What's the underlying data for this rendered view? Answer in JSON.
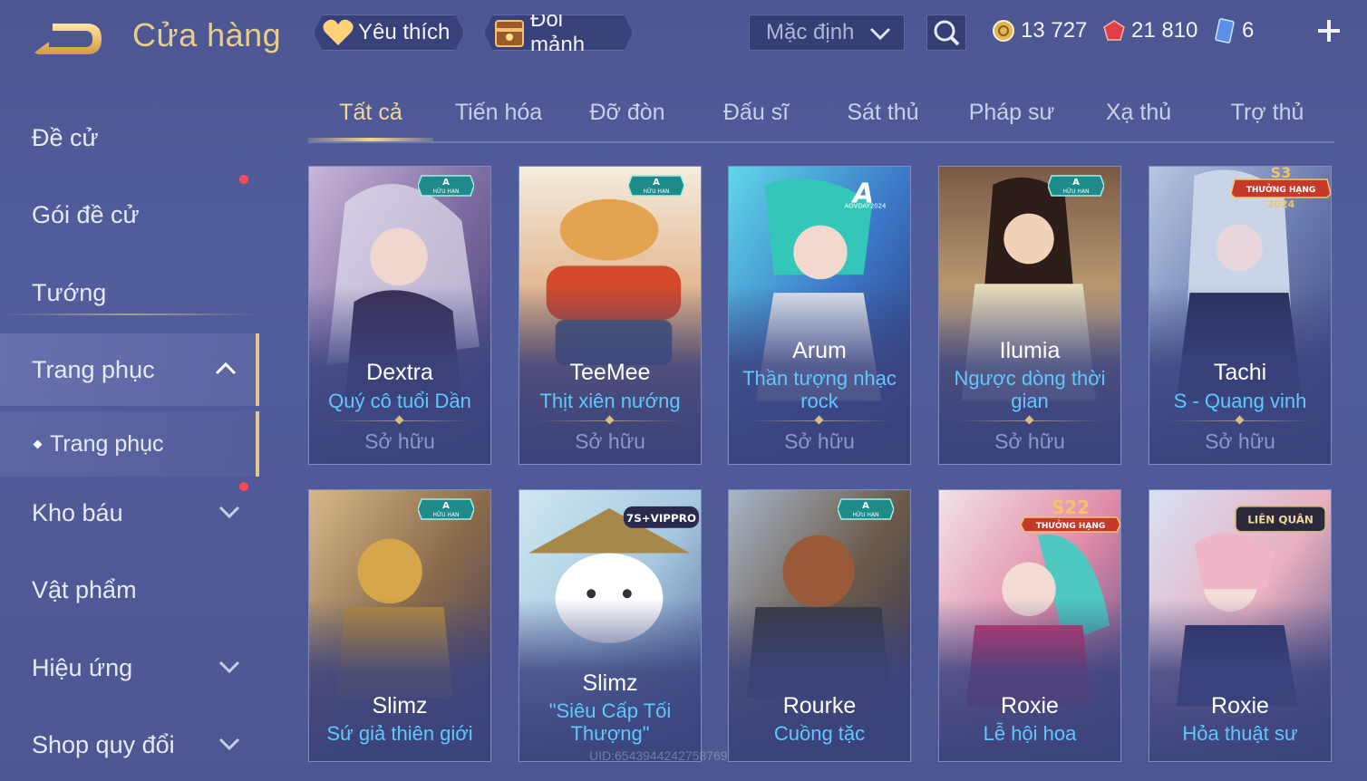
{
  "header": {
    "title": "Cửa hàng",
    "favorite_label": "Yêu thích",
    "trade_label": "Đổi mảnh",
    "sort_value": "Mặc định",
    "currencies": [
      {
        "icon": "gold-coin-icon",
        "value": "13 727"
      },
      {
        "icon": "red-gem-icon",
        "value": "21 810"
      },
      {
        "icon": "blue-card-icon",
        "value": "6"
      }
    ]
  },
  "sidebar": {
    "items": [
      {
        "label": "Đề cử"
      },
      {
        "label": "Gói đề cử"
      },
      {
        "label": "Tướng"
      },
      {
        "label": "Trang phục"
      },
      {
        "label": "Trang phục"
      },
      {
        "label": "Kho báu"
      },
      {
        "label": "Vật phẩm"
      },
      {
        "label": "Hiệu ứng"
      },
      {
        "label": "Shop quy đổi"
      }
    ]
  },
  "tabs": [
    {
      "label": "Tất cả"
    },
    {
      "label": "Tiến hóa"
    },
    {
      "label": "Đỡ đòn"
    },
    {
      "label": "Đấu sĩ"
    },
    {
      "label": "Sát thủ"
    },
    {
      "label": "Pháp sư"
    },
    {
      "label": "Xạ thủ"
    },
    {
      "label": "Trợ thủ"
    }
  ],
  "cards": [
    {
      "hero": "Dextra",
      "skin": "Quý cô tuổi Dần",
      "status": "Sở hữu",
      "badge": "A",
      "badge_sub": "HỮU HẠN"
    },
    {
      "hero": "TeeMee",
      "skin": "Thịt xiên nướng",
      "status": "Sở hữu",
      "badge": "A",
      "badge_sub": "HỮU HẠN"
    },
    {
      "hero": "Arum",
      "skin": "Thần tượng nhạc rock",
      "status": "Sở hữu",
      "badge": "A",
      "badge_sub": "AOVDAY2024"
    },
    {
      "hero": "Ilumia",
      "skin": "Ngược dòng thời gian",
      "status": "Sở hữu",
      "badge": "A",
      "badge_sub": "HỮU HẠN"
    },
    {
      "hero": "Tachi",
      "skin": "S - Quang vinh",
      "status": "Sở hữu",
      "badge": "S3",
      "badge_sub": "THƯỞNG HẠNG",
      "badge_year": "2024"
    },
    {
      "hero": "Slimz",
      "skin": "Sứ giả thiên giới",
      "badge": "A",
      "badge_sub": "HỮU HẠN"
    },
    {
      "hero": "Slimz",
      "skin": "\"Siêu Cấp Tối Thượng\"",
      "badge": "7S+VIPPRO"
    },
    {
      "hero": "Rourke",
      "skin": "Cuồng tặc",
      "badge": "A",
      "badge_sub": "HỮU HẠN"
    },
    {
      "hero": "Roxie",
      "skin": "Lễ hội hoa",
      "badge": "S22",
      "badge_sub": "THƯỞNG HẠNG"
    },
    {
      "hero": "Roxie",
      "skin": "Hỏa thuật sư",
      "badge": "LIÊN QUÂN"
    }
  ],
  "watermark": "UID:6543944242758769",
  "colors": {
    "accent": "#e8cc8a",
    "skin_name": "#5ec8ff",
    "background": "#4f5996"
  }
}
